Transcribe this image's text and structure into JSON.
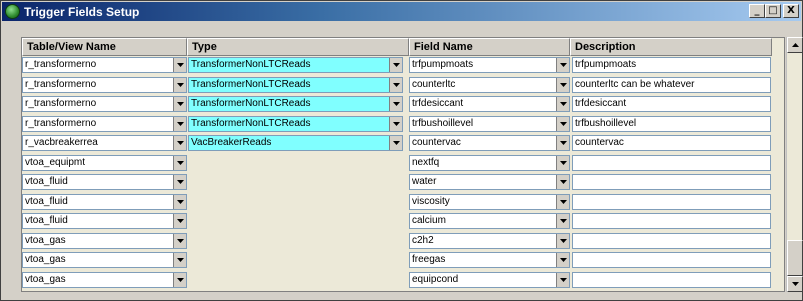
{
  "window": {
    "title": "Trigger Fields Setup",
    "icon": "green-globe-icon",
    "controls": [
      "_",
      "□",
      "X"
    ]
  },
  "columns": {
    "table_view": "Table/View Name",
    "type": "Type",
    "field_name": "Field Name",
    "description": "Description"
  },
  "rows": [
    {
      "table": "r_transformerno",
      "type": "TransformerNonLTCReads",
      "field": "trfpumpmoats",
      "description": "trfpumpmoats"
    },
    {
      "table": "r_transformerno",
      "type": "TransformerNonLTCReads",
      "field": "counterltc",
      "description": "counterltc can be whatever"
    },
    {
      "table": "r_transformerno",
      "type": "TransformerNonLTCReads",
      "field": "trfdesiccant",
      "description": "trfdesiccant"
    },
    {
      "table": "r_transformerno",
      "type": "TransformerNonLTCReads",
      "field": "trfbushoillevel",
      "description": "trfbushoillevel"
    },
    {
      "table": "r_vacbreakerrea",
      "type": "VacBreakerReads",
      "field": "countervac",
      "description": "countervac"
    },
    {
      "table": "vtoa_equipmt",
      "type": "",
      "field": "nextfq",
      "description": ""
    },
    {
      "table": "vtoa_fluid",
      "type": "",
      "field": "water",
      "description": ""
    },
    {
      "table": "vtoa_fluid",
      "type": "",
      "field": "viscosity",
      "description": ""
    },
    {
      "table": "vtoa_fluid",
      "type": "",
      "field": "calcium",
      "description": ""
    },
    {
      "table": "vtoa_gas",
      "type": "",
      "field": "c2h2",
      "description": ""
    },
    {
      "table": "vtoa_gas",
      "type": "",
      "field": "freegas",
      "description": ""
    },
    {
      "table": "vtoa_gas",
      "type": "",
      "field": "equipcond",
      "description": ""
    }
  ],
  "colors": {
    "type_highlight": "#80ffff",
    "title_bar": "#0a246a"
  }
}
